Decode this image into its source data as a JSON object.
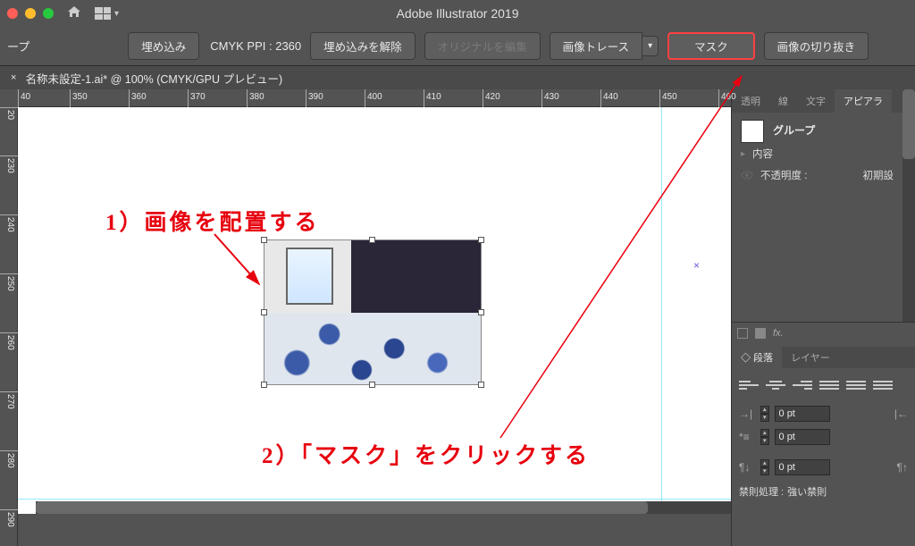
{
  "app_title": "Adobe Illustrator 2019",
  "controlbar": {
    "group_label": "ープ",
    "embed_btn": "埋め込み",
    "info": "CMYK  PPI : 2360",
    "unembed_btn": "埋め込みを解除",
    "edit_original_btn": "オリジナルを編集",
    "image_trace_btn": "画像トレース",
    "mask_btn": "マスク",
    "crop_btn": "画像の切り抜き"
  },
  "doc_tab": {
    "title": "名称未設定-1.ai* @ 100% (CMYK/GPU プレビュー)"
  },
  "ruler_h": [
    "40",
    "350",
    "360",
    "370",
    "380",
    "390",
    "400",
    "410",
    "420",
    "430",
    "440",
    "450",
    "460"
  ],
  "ruler_v": [
    "20",
    "230",
    "240",
    "250",
    "260",
    "270",
    "280",
    "290"
  ],
  "annotations": {
    "a1": "1）画像を配置する",
    "a2": "2）「マスク」をクリックする"
  },
  "right_panel": {
    "tabs": [
      "透明",
      "線",
      "文字",
      "アピアラ"
    ],
    "group_label": "グループ",
    "contents_label": "内容",
    "opacity_label": "不透明度 :",
    "opacity_value": "初期設",
    "fx_label": "fx.",
    "tabs2": [
      "段落",
      "レイヤー"
    ],
    "spacing_values": {
      "indent_left": "0 pt",
      "indent_left2": "0 pt",
      "space_before": "0 pt"
    },
    "kinsoku_label": "禁則処理 :",
    "kinsoku_value": "強い禁則"
  }
}
